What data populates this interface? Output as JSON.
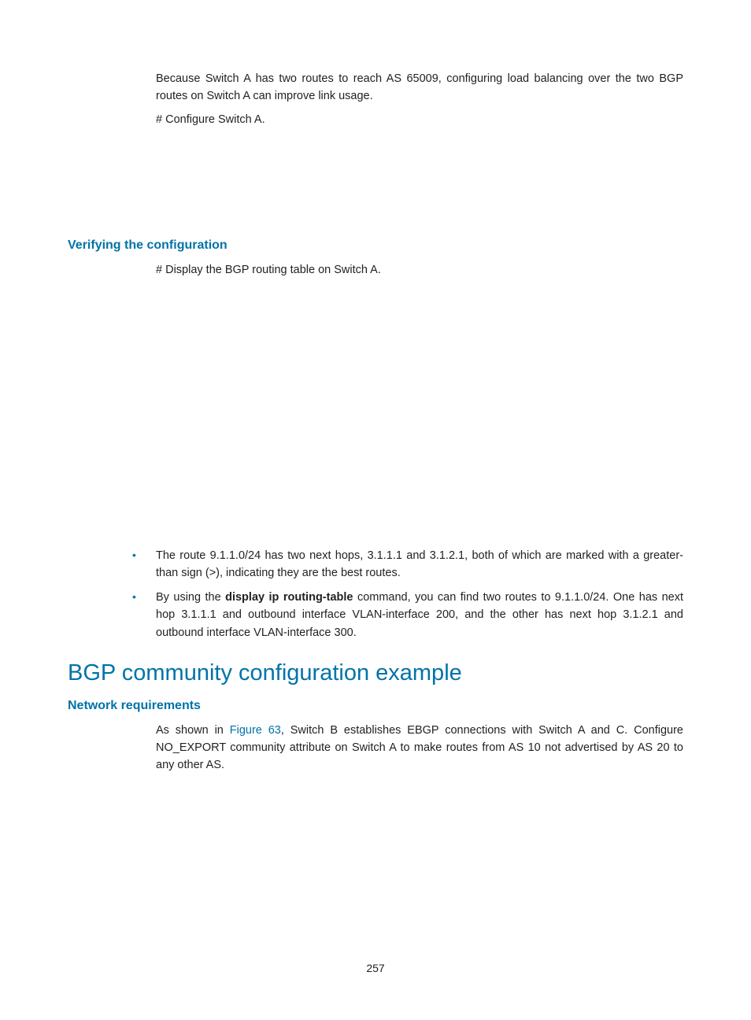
{
  "intro": {
    "p1": "Because Switch A has two routes to reach AS 65009, configuring load balancing over the two BGP routes on Switch A can improve link usage.",
    "p2": "# Configure Switch A."
  },
  "verify": {
    "heading": "Verifying the configuration",
    "p1": "# Display the BGP routing table on Switch A."
  },
  "bullets": {
    "b1": "The route 9.1.1.0/24 has two next hops, 3.1.1.1 and 3.1.2.1, both of which are marked with a greater-than sign (>), indicating they are the best routes.",
    "b2_pre": "By using the ",
    "b2_cmd": "display ip routing-table",
    "b2_post": " command, you can find two routes to 9.1.1.0/24. One has next hop 3.1.1.1 and outbound interface VLAN-interface 200, and the other has next hop 3.1.2.1 and outbound interface VLAN-interface 300."
  },
  "community": {
    "heading": "BGP community configuration example",
    "subheading": "Network requirements",
    "p1_pre": "As shown in ",
    "p1_link": "Figure 63",
    "p1_post": ", Switch B establishes EBGP connections with Switch A and C. Configure NO_EXPORT community attribute on Switch A to make routes from AS 10 not advertised by AS 20 to any other AS."
  },
  "page_number": "257"
}
